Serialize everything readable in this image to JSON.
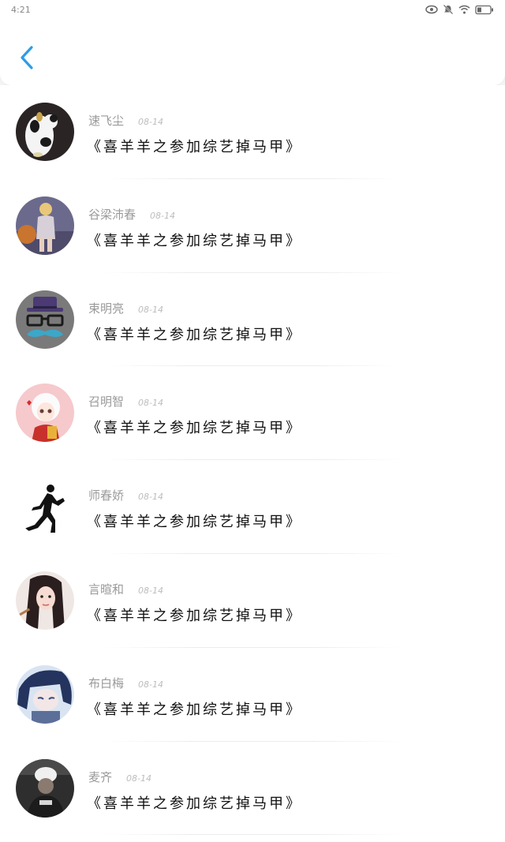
{
  "status_bar": {
    "time": "4:21",
    "icons": [
      "eye-icon",
      "bell-muted-icon",
      "wifi-icon",
      "battery-icon"
    ]
  },
  "header": {
    "back_icon": "chevron-left-icon",
    "accent": "#2b9de8"
  },
  "items": [
    {
      "user": "速飞尘",
      "date": "08-14",
      "title": "《喜羊羊之参加综艺掉马甲》",
      "avatar": "cow-cartoon"
    },
    {
      "user": "谷梁沛春",
      "date": "08-14",
      "title": "《喜羊羊之参加综艺掉马甲》",
      "avatar": "girl-photo"
    },
    {
      "user": "束明亮",
      "date": "08-14",
      "title": "《喜羊羊之参加综艺掉马甲》",
      "avatar": "hat-glasses-mustache"
    },
    {
      "user": "召明智",
      "date": "08-14",
      "title": "《喜羊羊之参加综艺掉马甲》",
      "avatar": "anime-white-hair"
    },
    {
      "user": "师春娇",
      "date": "08-14",
      "title": "《喜羊羊之参加综艺掉马甲》",
      "avatar": "runner-silhouette"
    },
    {
      "user": "言暄和",
      "date": "08-14",
      "title": "《喜羊羊之参加综艺掉马甲》",
      "avatar": "girl-portrait"
    },
    {
      "user": "布白梅",
      "date": "08-14",
      "title": "《喜羊羊之参加综艺掉马甲》",
      "avatar": "anime-blue-hair"
    },
    {
      "user": "麦齐",
      "date": "08-14",
      "title": "《喜羊羊之参加综艺掉马甲》",
      "avatar": "person-dark-cap"
    }
  ]
}
